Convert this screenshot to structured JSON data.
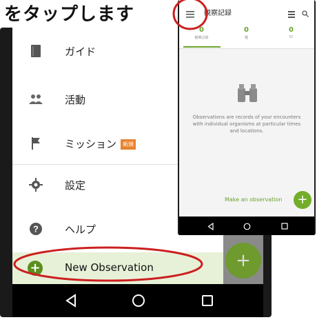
{
  "caption": "をタップします",
  "drawer": {
    "items": [
      {
        "label": "ガイド",
        "icon": "book-icon"
      },
      {
        "label": "活動",
        "icon": "people-icon"
      },
      {
        "label": "ミッション",
        "icon": "flag-icon",
        "badge": "新規"
      },
      {
        "label": "設定",
        "icon": "gear-icon"
      },
      {
        "label": "ヘルプ",
        "icon": "help-icon"
      }
    ],
    "new_observation": "New Observation",
    "fab_label": "+"
  },
  "front_screen": {
    "title": "観察記録",
    "tabs": [
      {
        "count": "0",
        "label": "観察記録"
      },
      {
        "count": "0",
        "label": "種"
      },
      {
        "count": "0",
        "label": "ID"
      }
    ],
    "empty_message": "Observations are records of your encounters with individual organisms at particular times and locations.",
    "make_observation": "Make an observation",
    "fab_label": "+"
  },
  "colors": {
    "accent_green": "#74ad2a",
    "highlight_red": "#cc1f1f",
    "badge_orange": "#e8822e",
    "selected_bg": "#e7f1d8"
  }
}
